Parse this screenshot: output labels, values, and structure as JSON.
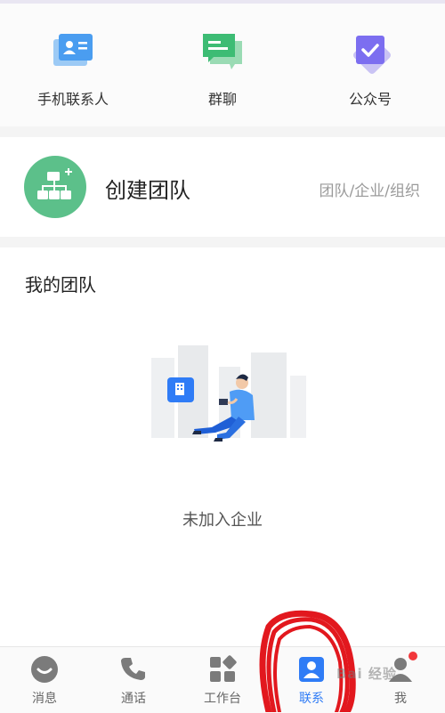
{
  "quick_actions": [
    {
      "label": "手机联系人",
      "icon": "phone-contacts-icon"
    },
    {
      "label": "群聊",
      "icon": "group-chat-icon"
    },
    {
      "label": "公众号",
      "icon": "official-account-icon"
    }
  ],
  "create_team": {
    "title": "创建团队",
    "subtitle": "团队/企业/组织",
    "icon": "org-chart-icon",
    "color": "#5cc08a"
  },
  "my_team": {
    "title": "我的团队",
    "empty_text": "未加入企业"
  },
  "tabs": [
    {
      "label": "消息",
      "icon": "message-icon"
    },
    {
      "label": "通话",
      "icon": "phone-icon"
    },
    {
      "label": "工作台",
      "icon": "workbench-icon"
    },
    {
      "label": "联系",
      "icon": "contacts-icon",
      "active": true
    },
    {
      "label": "我",
      "icon": "profile-icon",
      "badge": true
    }
  ],
  "colors": {
    "accent": "#2f7cf6",
    "badge": "#f2373b",
    "annotation": "#e2181e"
  },
  "watermark": "Bai 经验"
}
